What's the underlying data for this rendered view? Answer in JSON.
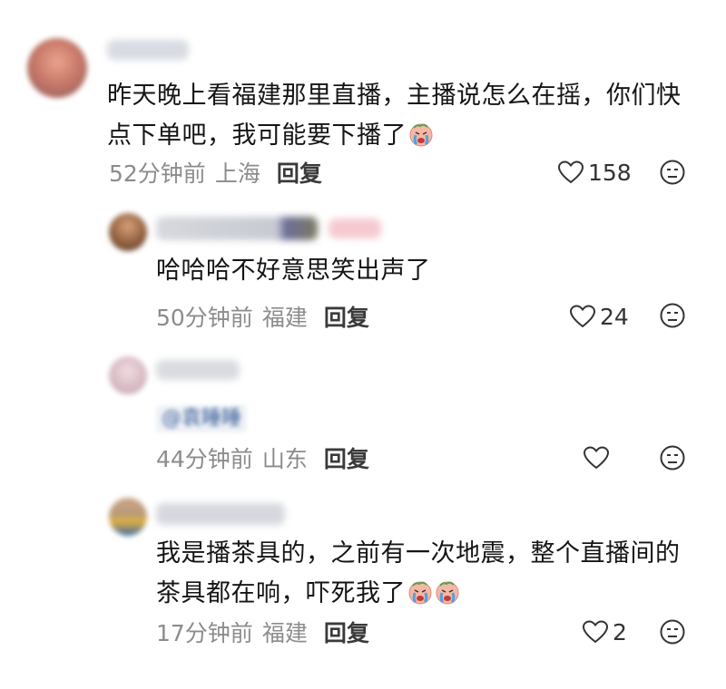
{
  "comments": [
    {
      "text": "昨天晚上看福建那里直播，主播说怎么在摇，你们快点下单吧，我可能要下播了",
      "time": "52分钟前",
      "location": "上海",
      "reply_label": "回复",
      "likes": "158",
      "emoji": "crying-face-icon"
    },
    {
      "text": "哈哈哈不好意思笑出声了",
      "time": "50分钟前",
      "location": "福建",
      "reply_label": "回复",
      "likes": "24"
    },
    {
      "mention": "@袁睡睡",
      "time": "44分钟前",
      "location": "山东",
      "reply_label": "回复",
      "likes": ""
    },
    {
      "text": "我是播茶具的，之前有一次地震，整个直播间的茶具都在响，吓死我了",
      "time": "17分钟前",
      "location": "福建",
      "reply_label": "回复",
      "likes": "2",
      "emoji": "crying-face-icon"
    }
  ],
  "colors": {
    "meta": "#8c8c8c",
    "text": "#151515",
    "mention": "#3b5f99"
  }
}
